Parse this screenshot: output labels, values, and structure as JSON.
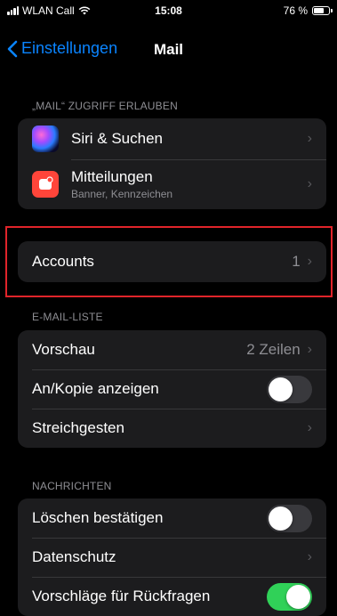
{
  "status_bar": {
    "carrier": "WLAN Call",
    "time": "15:08",
    "battery_text": "76 %",
    "battery_level": 0.76
  },
  "nav": {
    "back_label": "Einstellungen",
    "title": "Mail"
  },
  "section_access": {
    "header": "„MAIL“ ZUGRIFF ERLAUBEN",
    "items": [
      {
        "label": "Siri & Suchen",
        "icon": "siri-icon"
      },
      {
        "label": "Mitteilungen",
        "sublabel": "Banner, Kennzeichen",
        "icon": "notification-icon"
      }
    ]
  },
  "accounts": {
    "label": "Accounts",
    "value": "1",
    "highlight_color": "#e0242a"
  },
  "section_list": {
    "header": "E-MAIL-LISTE",
    "preview": {
      "label": "Vorschau",
      "value": "2 Zeilen"
    },
    "cc": {
      "label": "An/Kopie anzeigen",
      "on": false
    },
    "swipe": {
      "label": "Streichgesten"
    }
  },
  "section_messages": {
    "header": "NACHRICHTEN",
    "confirm_delete": {
      "label": "Löschen bestätigen",
      "on": false
    },
    "privacy": {
      "label": "Datenschutz"
    },
    "followup": {
      "label": "Vorschläge für Rückfragen",
      "on": true
    }
  },
  "colors": {
    "accent": "#0a84ff",
    "toggle_on": "#30d158",
    "background": "#000000",
    "cell": "#1c1c1e"
  }
}
